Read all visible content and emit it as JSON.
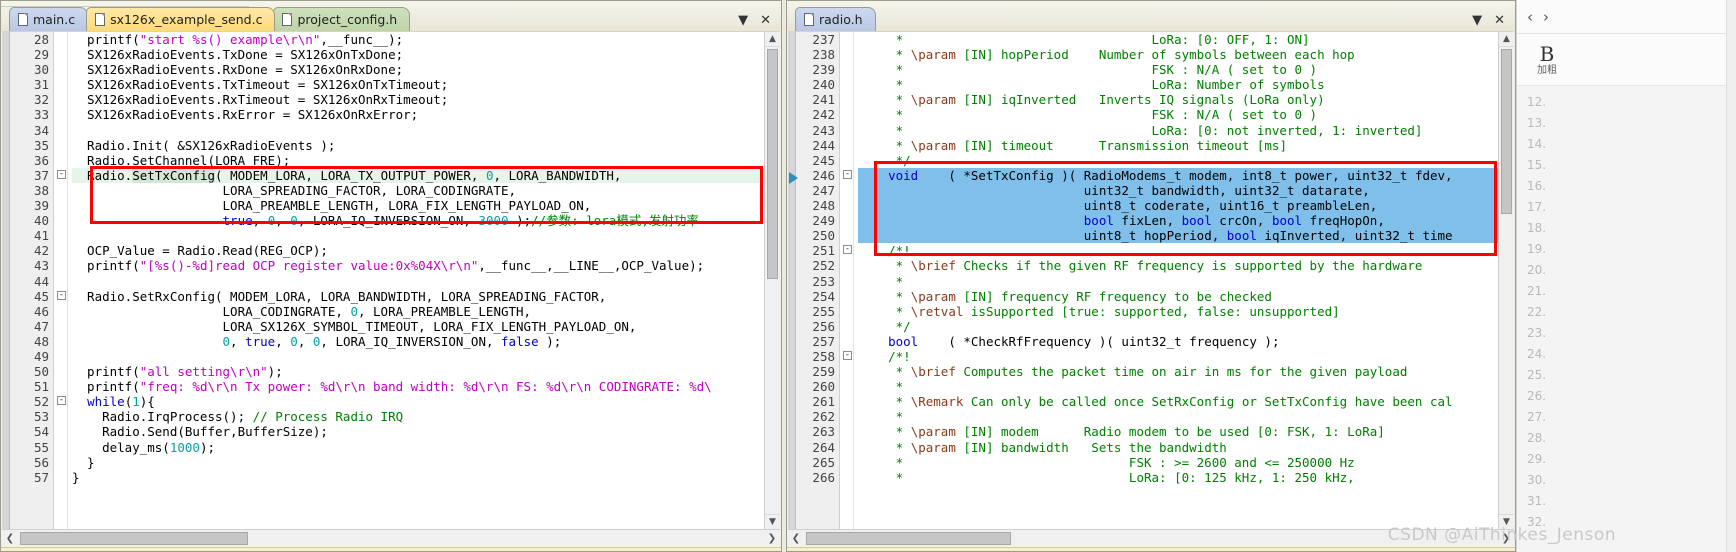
{
  "left_pane": {
    "tabs": [
      {
        "label": "main.c",
        "color": "blue",
        "active": false,
        "icon": "document-icon"
      },
      {
        "label": "sx126x_example_send.c",
        "color": "yellow",
        "active": true,
        "icon": "document-icon"
      },
      {
        "label": "project_config.h",
        "color": "green",
        "active": false,
        "icon": "document-icon"
      }
    ],
    "tab_controls": [
      {
        "name": "tab-list-dropdown",
        "glyph": "▼"
      },
      {
        "name": "close-pane-button",
        "glyph": "✕"
      }
    ],
    "first_line_number": 28,
    "lines": [
      {
        "n": 28,
        "text": "  printf(\"start %s() example\\r\\n\",__func__);"
      },
      {
        "n": 29,
        "text": "  SX126xRadioEvents.TxDone = SX126xOnTxDone;"
      },
      {
        "n": 30,
        "text": "  SX126xRadioEvents.RxDone = SX126xOnRxDone;"
      },
      {
        "n": 31,
        "text": "  SX126xRadioEvents.TxTimeout = SX126xOnTxTimeout;"
      },
      {
        "n": 32,
        "text": "  SX126xRadioEvents.RxTimeout = SX126xOnRxTimeout;"
      },
      {
        "n": 33,
        "text": "  SX126xRadioEvents.RxError = SX126xOnRxError;"
      },
      {
        "n": 34,
        "text": ""
      },
      {
        "n": 35,
        "text": "  Radio.Init( &SX126xRadioEvents );"
      },
      {
        "n": 36,
        "text": "  Radio.SetChannel(LORA_FRE);"
      },
      {
        "n": 37,
        "text": "  Radio.SetTxConfig( MODEM_LORA, LORA_TX_OUTPUT_POWER, 0, LORA_BANDWIDTH,"
      },
      {
        "n": 38,
        "text": "                    LORA_SPREADING_FACTOR, LORA_CODINGRATE,"
      },
      {
        "n": 39,
        "text": "                    LORA_PREAMBLE_LENGTH, LORA_FIX_LENGTH_PAYLOAD_ON,"
      },
      {
        "n": 40,
        "text": "                    true, 0, 0, LORA_IQ_INVERSION_ON, 3000 );//参数: lora模式,发射功率"
      },
      {
        "n": 41,
        "text": ""
      },
      {
        "n": 42,
        "text": "  OCP_Value = Radio.Read(REG_OCP);"
      },
      {
        "n": 43,
        "text": "  printf(\"[%s()-%d]read OCP register value:0x%04X\\r\\n\",__func__,__LINE__,OCP_Value);"
      },
      {
        "n": 44,
        "text": ""
      },
      {
        "n": 45,
        "text": "  Radio.SetRxConfig( MODEM_LORA, LORA_BANDWIDTH, LORA_SPREADING_FACTOR,"
      },
      {
        "n": 46,
        "text": "                    LORA_CODINGRATE, 0, LORA_PREAMBLE_LENGTH,"
      },
      {
        "n": 47,
        "text": "                    LORA_SX126X_SYMBOL_TIMEOUT, LORA_FIX_LENGTH_PAYLOAD_ON,"
      },
      {
        "n": 48,
        "text": "                    0, true, 0, 0, LORA_IQ_INVERSION_ON, false );"
      },
      {
        "n": 49,
        "text": ""
      },
      {
        "n": 50,
        "text": "  printf(\"all setting\\r\\n\");"
      },
      {
        "n": 51,
        "text": "  printf(\"freq: %d\\r\\n Tx power: %d\\r\\n band width: %d\\r\\n FS: %d\\r\\n CODINGRATE: %d\\"
      },
      {
        "n": 52,
        "text": "  while(1){"
      },
      {
        "n": 53,
        "text": "    Radio.IrqProcess(); // Process Radio IRQ"
      },
      {
        "n": 54,
        "text": "    Radio.Send(Buffer,BufferSize);"
      },
      {
        "n": 55,
        "text": "    delay_ms(1000);"
      },
      {
        "n": 56,
        "text": "  }"
      },
      {
        "n": 57,
        "text": "}"
      }
    ],
    "highlight_box_label": "settxconfig-call-annotation",
    "scroll": {
      "v_thumb_pct": 55,
      "h_thumb_pct": 30
    }
  },
  "right_pane": {
    "tabs": [
      {
        "label": "radio.h",
        "color": "blue",
        "active": true,
        "icon": "document-icon"
      }
    ],
    "tab_controls": [
      {
        "name": "tab-list-dropdown",
        "glyph": "▼"
      },
      {
        "name": "close-pane-button",
        "glyph": "✕"
      }
    ],
    "first_line_number": 237,
    "lines": [
      {
        "n": 237,
        "text": "     *                                 LoRa: [0: OFF, 1: ON]"
      },
      {
        "n": 238,
        "text": "     * \\param [IN] hopPeriod    Number of symbols between each hop"
      },
      {
        "n": 239,
        "text": "     *                                 FSK : N/A ( set to 0 )"
      },
      {
        "n": 240,
        "text": "     *                                 LoRa: Number of symbols"
      },
      {
        "n": 241,
        "text": "     * \\param [IN] iqInverted   Inverts IQ signals (LoRa only)"
      },
      {
        "n": 242,
        "text": "     *                                 FSK : N/A ( set to 0 )"
      },
      {
        "n": 243,
        "text": "     *                                 LoRa: [0: not inverted, 1: inverted]"
      },
      {
        "n": 244,
        "text": "     * \\param [IN] timeout      Transmission timeout [ms]"
      },
      {
        "n": 245,
        "text": "     */"
      },
      {
        "n": 246,
        "text": "    void    ( *SetTxConfig )( RadioModems_t modem, int8_t power, uint32_t fdev,"
      },
      {
        "n": 247,
        "text": "                              uint32_t bandwidth, uint32_t datarate,"
      },
      {
        "n": 248,
        "text": "                              uint8_t coderate, uint16_t preambleLen,"
      },
      {
        "n": 249,
        "text": "                              bool fixLen, bool crcOn, bool freqHopOn,"
      },
      {
        "n": 250,
        "text": "                              uint8_t hopPeriod, bool iqInverted, uint32_t time"
      },
      {
        "n": 251,
        "text": "    /*!"
      },
      {
        "n": 252,
        "text": "     * \\brief Checks if the given RF frequency is supported by the hardware"
      },
      {
        "n": 253,
        "text": "     *"
      },
      {
        "n": 254,
        "text": "     * \\param [IN] frequency RF frequency to be checked"
      },
      {
        "n": 255,
        "text": "     * \\retval isSupported [true: supported, false: unsupported]"
      },
      {
        "n": 256,
        "text": "     */"
      },
      {
        "n": 257,
        "text": "    bool    ( *CheckRfFrequency )( uint32_t frequency );"
      },
      {
        "n": 258,
        "text": "    /*!"
      },
      {
        "n": 259,
        "text": "     * \\brief Computes the packet time on air in ms for the given payload"
      },
      {
        "n": 260,
        "text": "     *"
      },
      {
        "n": 261,
        "text": "     * \\Remark Can only be called once SetRxConfig or SetTxConfig have been cal"
      },
      {
        "n": 262,
        "text": "     *"
      },
      {
        "n": 263,
        "text": "     * \\param [IN] modem      Radio modem to be used [0: FSK, 1: LoRa]"
      },
      {
        "n": 264,
        "text": "     * \\param [IN] bandwidth   Sets the bandwidth"
      },
      {
        "n": 265,
        "text": "     *                              FSK : >= 2600 and <= 250000 Hz"
      },
      {
        "n": 266,
        "text": "     *                              LoRa: [0: 125 kHz, 1: 250 kHz,"
      }
    ],
    "selection_lines": [
      246,
      247,
      248,
      249,
      250
    ],
    "highlight_box_label": "settxconfig-declaration-annotation",
    "scroll": {
      "v_thumb_pct": 40,
      "h_thumb_pct": 28
    }
  },
  "side_panel": {
    "nav": {
      "back_glyph": "‹",
      "forward_glyph": "›"
    },
    "toolbar": {
      "bold_glyph": "B",
      "bold_caption": "加粗"
    },
    "list_items": [
      {
        "label": "12."
      },
      {
        "label": "13."
      },
      {
        "label": "14."
      },
      {
        "label": "15."
      },
      {
        "label": "16."
      },
      {
        "label": "17."
      },
      {
        "label": "18."
      },
      {
        "label": "19."
      },
      {
        "label": "20."
      },
      {
        "label": "21."
      },
      {
        "label": "22."
      },
      {
        "label": "23."
      },
      {
        "label": "24."
      },
      {
        "label": "25."
      },
      {
        "label": "26."
      },
      {
        "label": "27."
      },
      {
        "label": "28."
      },
      {
        "label": "29."
      },
      {
        "label": "30."
      },
      {
        "label": "31."
      },
      {
        "label": "32."
      }
    ]
  },
  "watermark": {
    "text": "CSDN @AiThinkes_Jenson"
  },
  "colors": {
    "annotation_red": "#ff0000",
    "selection_blue": "#7fbfea",
    "current_line_green": "#e6f5e9",
    "keyword_blue": "#0000d0",
    "string_magenta": "#c000c0",
    "comment_green": "#008000",
    "doc_tag_brown": "#8b3a1a",
    "number_teal": "#0aa0a8"
  }
}
